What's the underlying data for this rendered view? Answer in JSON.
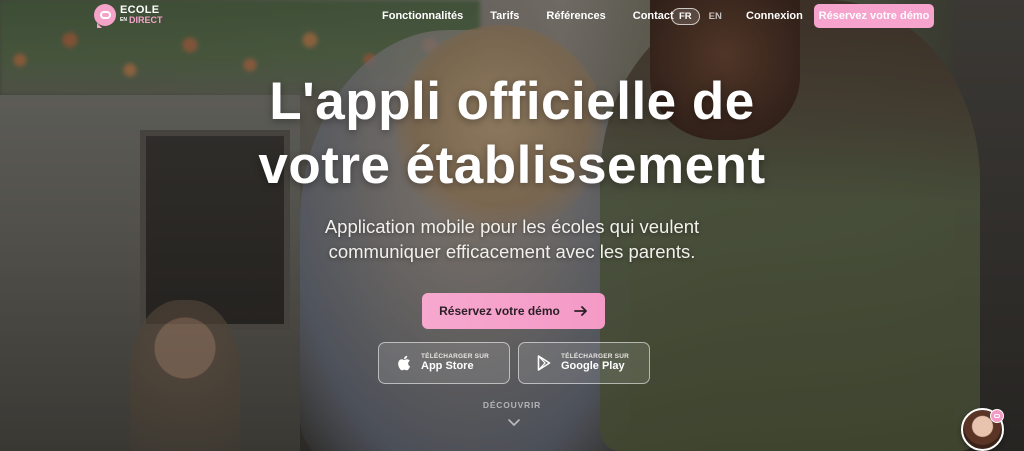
{
  "brand": {
    "name_top": "ECOLE",
    "name_small": "EN",
    "name_bottom": "DIRECT",
    "icon": "chat-bubble-logo-icon",
    "accent_color": "#f6a3cd"
  },
  "nav": {
    "links": [
      "Fonctionnalités",
      "Tarifs",
      "Références",
      "Contact"
    ],
    "lang_active": "FR",
    "lang_other": "EN",
    "login": "Connexion",
    "cta": "Réservez votre démo"
  },
  "hero": {
    "title_line1": "L'appli officielle de",
    "title_line2": "votre établissement",
    "subtitle_line1": "Application mobile pour les écoles qui veulent",
    "subtitle_line2": "communiquer efficacement avec les parents.",
    "cta": "Réservez votre démo",
    "cta_icon": "arrow-right-icon"
  },
  "stores": {
    "app_store": {
      "small": "TÉLÉCHARGER SUR",
      "big": "App Store",
      "icon": "apple-icon"
    },
    "google_play": {
      "small": "TÉLÉCHARGER SUR",
      "big": "Google Play",
      "icon": "play-icon"
    }
  },
  "discover": {
    "label": "DÉCOUVRIR",
    "icon": "chevron-down-icon"
  },
  "chat": {
    "avatar_icon": "support-avatar",
    "badge_icon": "chat-icon"
  }
}
